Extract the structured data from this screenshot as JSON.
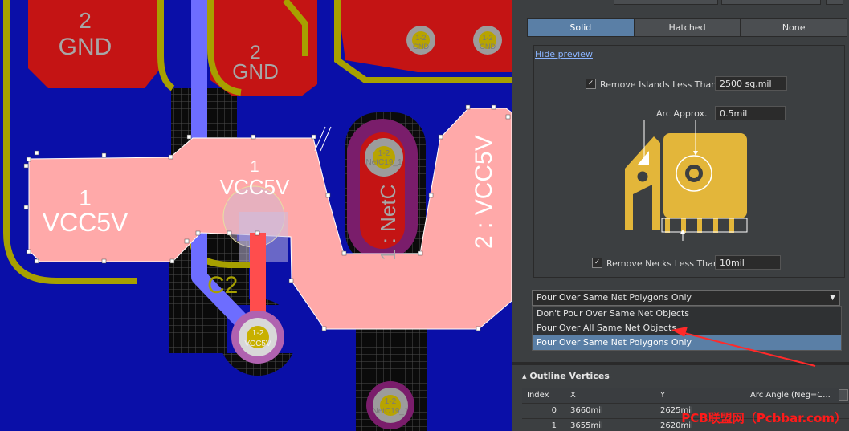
{
  "colors": {
    "board_blue": "#0a0fa8",
    "copper_red": "#c41414",
    "poly_pink": "#ffa9a9",
    "outline_olive": "#a7a000",
    "track_blue": "#6d6dff",
    "track_red": "#ff4d4d",
    "accent": "#5a7fa6",
    "pad_gold": "#e3b63a"
  },
  "pcb": {
    "net_labels": {
      "gnd_left_num": "2",
      "gnd_left_net": "GND",
      "gnd_mid_num": "2",
      "gnd_mid_net": "GND",
      "vcc_left_num": "1",
      "vcc_left_net": "VCC5V",
      "vcc_mid_num": "1",
      "vcc_mid_net": "VCC5V",
      "vcc_right": "2 : VCC5V",
      "netc19_vertical": "1 : NetC",
      "comp_label": "C2"
    },
    "vias": {
      "via_gnd_1_pad": "1-2",
      "via_gnd_1_net": "GND",
      "via_gnd_2_pad": "1-2",
      "via_gnd_2_net": "GND",
      "via_netc_top_pad": "1-2",
      "via_netc_top_net": "NetC19_1",
      "via_vcc_pad": "1-2",
      "via_vcc_net": "VCC5V",
      "via_netc_bottom_pad": "1-2",
      "via_netc_bottom_net": "NetC19_1"
    }
  },
  "panel": {
    "fill_modes": [
      "Solid",
      "Hatched",
      "None"
    ],
    "active_fill_mode": "Solid",
    "hide_preview_label": "Hide preview",
    "remove_islands": {
      "label": "Remove Islands Less Than",
      "checked": "✓",
      "value": "2500 sq.mil"
    },
    "arc_approx": {
      "label": "Arc Approx.",
      "value": "0.5mil"
    },
    "remove_necks": {
      "label": "Remove Necks Less Than",
      "checked": "✓",
      "value": "10mil"
    },
    "pour_over": {
      "selected": "Pour Over Same Net Polygons Only",
      "options": [
        "Don't Pour Over Same Net Objects",
        "Pour Over All Same Net Objects",
        "Pour Over Same Net Polygons Only"
      ]
    },
    "outline_vertices": {
      "title": "Outline Vertices",
      "columns": [
        "Index",
        "X",
        "Y",
        "Arc Angle (Neg=C..."
      ],
      "rows": [
        [
          "0",
          "3660mil",
          "2625mil",
          ""
        ],
        [
          "1",
          "3655mil",
          "2620mil",
          ""
        ]
      ]
    }
  },
  "watermark": "PCB联盟网（Pcbbar.com）"
}
